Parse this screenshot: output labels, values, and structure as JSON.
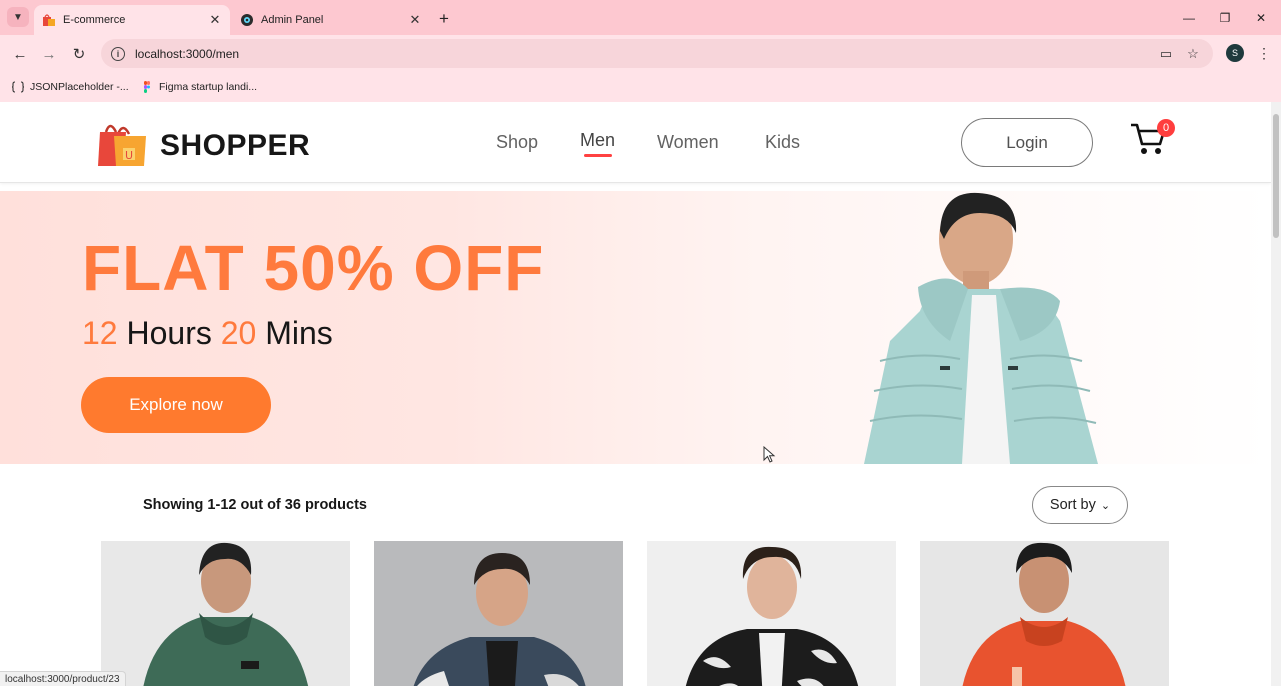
{
  "browser": {
    "tabs": [
      {
        "title": "E-commerce",
        "active": true
      },
      {
        "title": "Admin Panel",
        "active": false
      }
    ],
    "url": "localhost:3000/men",
    "profile_initial": "S",
    "bookmarks": [
      {
        "label": "JSONPlaceholder -..."
      },
      {
        "label": "Figma startup landi..."
      }
    ],
    "status_url": "localhost:3000/product/23"
  },
  "navbar": {
    "brand": "SHOPPER",
    "menu": [
      {
        "label": "Shop",
        "active": false
      },
      {
        "label": "Men",
        "active": true
      },
      {
        "label": "Women",
        "active": false
      },
      {
        "label": "Kids",
        "active": false
      }
    ],
    "login_label": "Login",
    "cart_count": "0"
  },
  "banner": {
    "headline": "FLAT 50% OFF",
    "hours_value": "12",
    "hours_label": "Hours",
    "mins_value": "20",
    "mins_label": "Mins",
    "cta_label": "Explore now"
  },
  "listing": {
    "showing_prefix": "Showing 1-12",
    "showing_suffix": "out of 36 products",
    "sort_label": "Sort by"
  },
  "colors": {
    "accent": "#ff7a3d",
    "nav_underline": "#ff4141",
    "chrome_tab": "#fdc8d0"
  },
  "icons": [
    "e-commerce-favicon",
    "admin-panel-favicon",
    "back-icon",
    "forward-icon",
    "reload-icon",
    "info-icon",
    "install-icon",
    "star-icon",
    "more-icon",
    "cart-icon",
    "shopping-bag-logo",
    "chevron-down-icon"
  ]
}
